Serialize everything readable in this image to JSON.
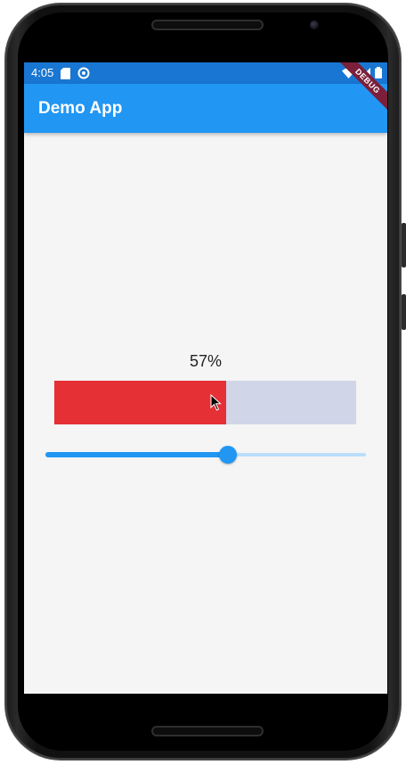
{
  "status_bar": {
    "time": "4:05",
    "left_icons": [
      "sd-card-icon",
      "sync-icon"
    ],
    "right_icons": [
      "wifi-icon",
      "signal-icon",
      "battery-icon"
    ]
  },
  "app_bar": {
    "title": "Demo App"
  },
  "debug_banner": {
    "label": "DEBUG"
  },
  "progress": {
    "label": "57%",
    "value": 0.57,
    "fill_color": "#e53035",
    "track_color": "#d1d5e8"
  },
  "slider": {
    "value": 0.57,
    "active_color": "#2196f3",
    "inactive_color": "#bbdefb"
  },
  "colors": {
    "status_bar": "#1976d2",
    "app_bar": "#2196f3",
    "background": "#f5f5f5"
  }
}
